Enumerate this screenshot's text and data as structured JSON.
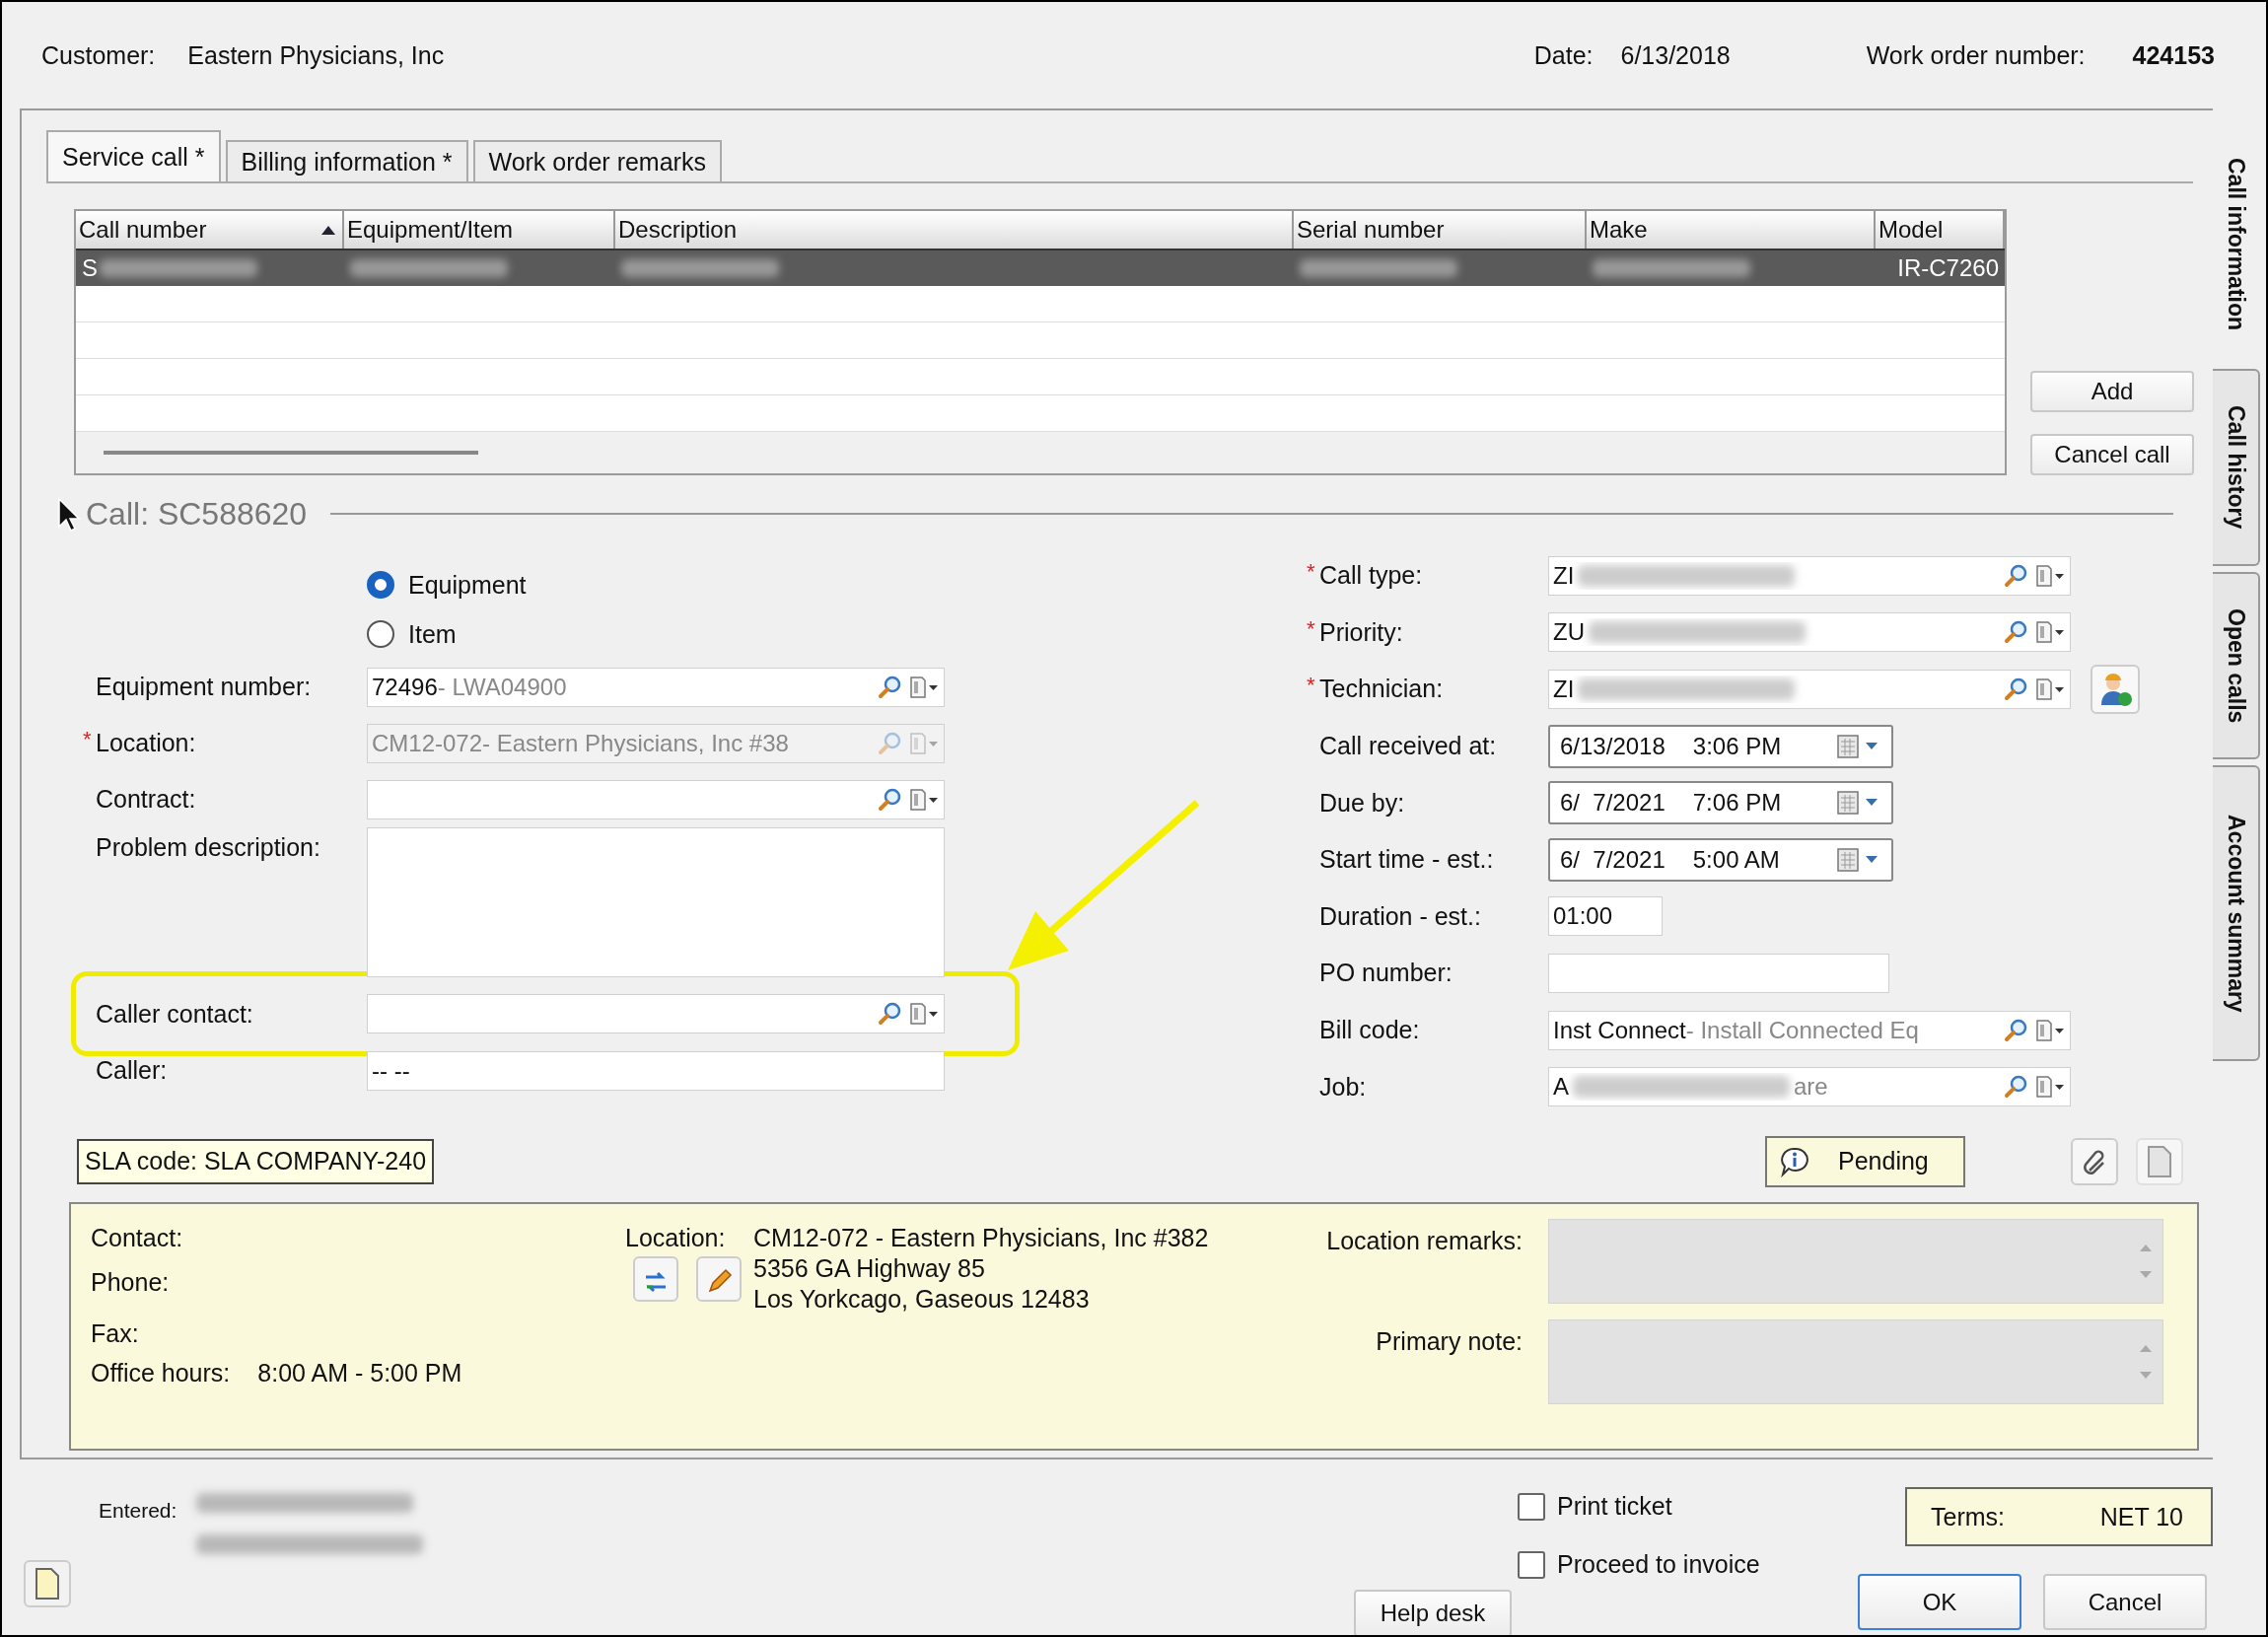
{
  "header": {
    "customer_label": "Customer:",
    "customer": "Eastern Physicians, Inc",
    "date_label": "Date:",
    "date": "6/13/2018",
    "work_order_label": "Work order number:",
    "work_order": "424153"
  },
  "tabs": [
    {
      "label": "Service call *",
      "selected": true
    },
    {
      "label": "Billing information  *",
      "selected": false
    },
    {
      "label": "Work order remarks",
      "selected": false
    }
  ],
  "side_tabs": [
    {
      "label": "Call information",
      "selected": true
    },
    {
      "label": "Call history",
      "selected": false
    },
    {
      "label": "Open calls",
      "selected": false
    },
    {
      "label": "Account summary",
      "selected": false
    }
  ],
  "calls_table": {
    "columns": [
      {
        "label": "Call number",
        "sorted": true
      },
      {
        "label": "Equipment/Item",
        "sorted": false
      },
      {
        "label": "Description",
        "sorted": false
      },
      {
        "label": "Serial number",
        "sorted": false
      },
      {
        "label": "Make",
        "sorted": false
      },
      {
        "label": "Model",
        "sorted": false
      }
    ],
    "rows": [
      {
        "selected": true,
        "cells": [
          {
            "text": "S",
            "blurred": true
          },
          {
            "blurred": true
          },
          {
            "blurred": true
          },
          {
            "blurred": true
          },
          {
            "blurred": true
          },
          {
            "text": "IR-C7260",
            "blurred": false
          }
        ]
      }
    ]
  },
  "call_actions": [
    "Add",
    "Cancel call"
  ],
  "call_title": "Call: SC588620",
  "item_type": [
    {
      "label": "Equipment",
      "selected": true
    },
    {
      "label": "Item",
      "selected": false
    }
  ],
  "left_fields": [
    {
      "kind": "lookup",
      "label": "Equipment number:",
      "disabled": false,
      "highlighted": false,
      "value": "72496",
      "description": "- LWA04900"
    },
    {
      "kind": "lookup",
      "label": "Location:",
      "required_mark": "*",
      "disabled": true,
      "highlighted": false,
      "value": "CM12-072",
      "description": "- Eastern Physicians, Inc #38"
    },
    {
      "kind": "lookup",
      "label": "Contract:",
      "disabled": false,
      "highlighted": false
    },
    {
      "kind": "textarea",
      "label": "Problem description:",
      "disabled": false,
      "highlighted": false
    },
    {
      "kind": "lookup",
      "label": "Caller contact:",
      "disabled": false,
      "highlighted": true
    },
    {
      "kind": "text",
      "label": "Caller:",
      "disabled": false,
      "highlighted": false,
      "value": "--  --"
    }
  ],
  "right_fields": [
    {
      "kind": "lookup",
      "label": "Call type:",
      "required_mark": "*",
      "blurred": true,
      "assign_button": false,
      "value": "ZI"
    },
    {
      "kind": "lookup",
      "label": "Priority:",
      "required_mark": "*",
      "blurred": true,
      "assign_button": false,
      "value": "ZU"
    },
    {
      "kind": "lookup",
      "label": "Technician:",
      "required_mark": "*",
      "blurred": true,
      "assign_button": true,
      "value": "ZI"
    },
    {
      "kind": "datetime",
      "label": "Call received at:",
      "blurred": false,
      "assign_button": false,
      "date": "6/13/2018",
      "time": "3:06 PM"
    },
    {
      "kind": "datetime",
      "label": "Due by:",
      "blurred": false,
      "assign_button": false,
      "date": "6/  7/2021",
      "time": "7:06 PM"
    },
    {
      "kind": "datetime",
      "label": "Start time - est.:",
      "blurred": false,
      "assign_button": false,
      "date": "6/  7/2021",
      "time": "5:00 AM"
    },
    {
      "kind": "short",
      "label": "Duration - est.:",
      "blurred": false,
      "assign_button": false,
      "value": "01:00"
    },
    {
      "kind": "medium",
      "label": "PO number:",
      "blurred": false,
      "assign_button": false
    },
    {
      "kind": "lookup",
      "label": "Bill code:",
      "blurred": false,
      "assign_button": false,
      "value": "Inst Connect",
      "description": "- Install Connected Eq"
    },
    {
      "kind": "lookup",
      "label": "Job:",
      "blurred": true,
      "assign_button": false,
      "value": "A",
      "tail": "are"
    }
  ],
  "sla_code": "SLA code: SLA COMPANY-240",
  "status_button": "Pending",
  "info": {
    "contact_label": "Contact:",
    "phone_label": "Phone:",
    "fax_label": "Fax:",
    "office_hours_label": "Office hours:",
    "office_hours": "8:00 AM - 5:00 PM",
    "location_label": "Location:",
    "location_lines": [
      "CM12-072 - Eastern Physicians, Inc #382",
      "5356 GA Highway 85",
      "Los Yorkcago, Gaseous 12483"
    ],
    "remarks_label": "Location remarks:",
    "note_label": "Primary note:"
  },
  "footer": {
    "entered_label": "Entered:",
    "help_button": "Help desk",
    "options": [
      {
        "label": "Print ticket",
        "checked": false
      },
      {
        "label": "Proceed to invoice",
        "checked": false
      }
    ],
    "terms_label": "Terms:",
    "terms": "NET 10",
    "buttons": [
      "OK",
      "Cancel"
    ]
  }
}
